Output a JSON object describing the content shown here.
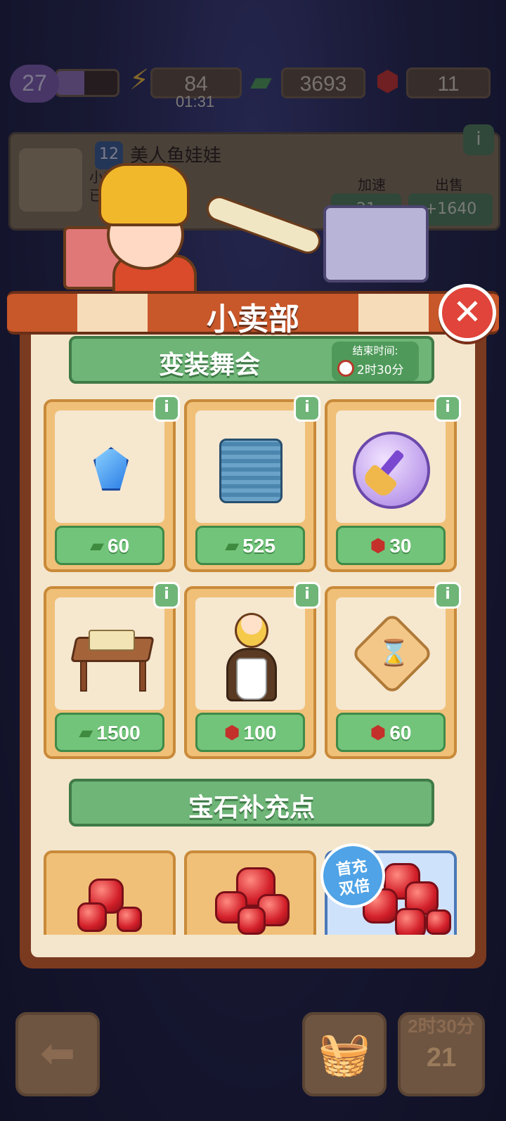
{
  "hud": {
    "level": "27",
    "level_progress": 0.45,
    "energy": "84",
    "energy_timer": "01:31",
    "cash": "3693",
    "gems": "11"
  },
  "item_card": {
    "level": "12",
    "name": "美人鱼娃娃",
    "desc_line1": "小美        要王子。",
    "desc_line2": "已         不能再合成。",
    "speedup_label": "加速",
    "sell_label": "出售",
    "speedup_value": "21",
    "sell_value": "+1640"
  },
  "shop": {
    "title": "小卖部",
    "event_banner": "变装舞会",
    "end_time_label": "结束时间:",
    "end_time_value": "2时30分",
    "items": [
      {
        "icon": "blue-crystal",
        "currency": "cash",
        "price": "60"
      },
      {
        "icon": "pajamas",
        "currency": "cash",
        "price": "525"
      },
      {
        "icon": "magic-broom",
        "currency": "gem",
        "price": "30"
      },
      {
        "icon": "desk-with-scroll",
        "currency": "cash",
        "price": "1500"
      },
      {
        "icon": "maid-girl",
        "currency": "gem",
        "price": "100"
      },
      {
        "icon": "hourglass-tile",
        "currency": "gem",
        "price": "60"
      }
    ],
    "gem_section_title": "宝石补充点",
    "double_badge_line1": "首充",
    "double_badge_line2": "双倍"
  },
  "bottom": {
    "timer": "2时30分",
    "count": "21"
  },
  "colors": {
    "awning_red": "#c8572a",
    "banner_green": "#6fb578",
    "price_green": "#72c47a",
    "close_red": "#e0443a"
  }
}
